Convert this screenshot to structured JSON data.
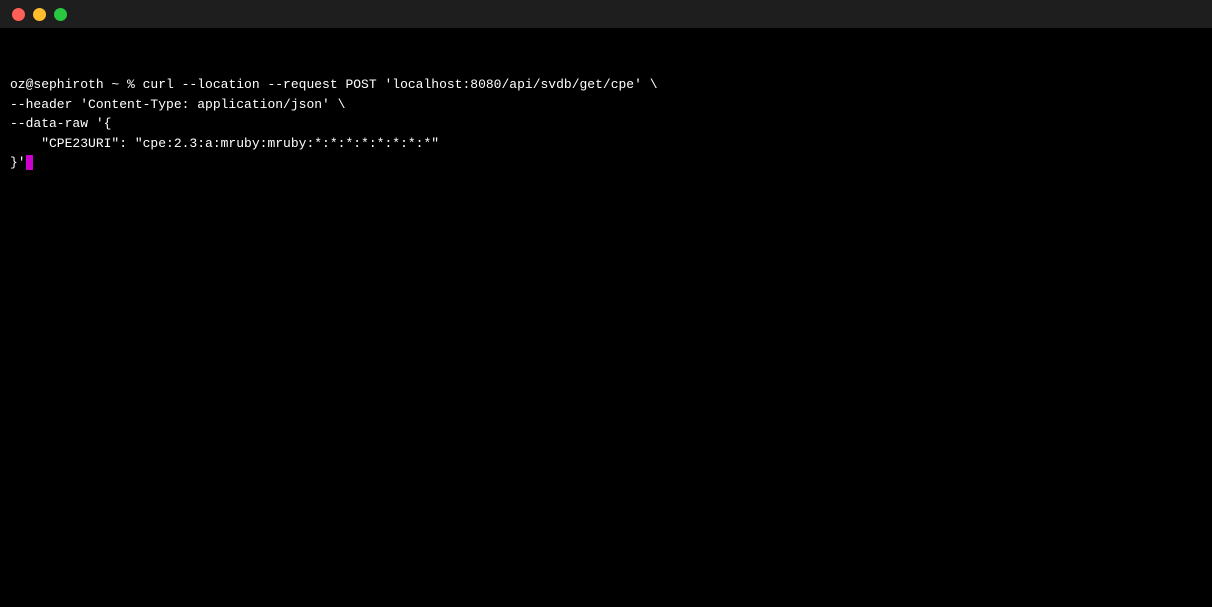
{
  "titlebar": {
    "close_label": "",
    "minimize_label": "",
    "maximize_label": ""
  },
  "terminal": {
    "prompt": "oz@sephiroth ~ % ",
    "line1": "curl --location --request POST 'localhost:8080/api/svdb/get/cpe' \\",
    "line2": "--header 'Content-Type: application/json' \\",
    "line3": "--data-raw '{",
    "line4": "    \"CPE23URI\": \"cpe:2.3:a:mruby:mruby:*:*:*:*:*:*:*:*\"",
    "line5_prefix": "}'",
    "cursor_char": "'"
  }
}
